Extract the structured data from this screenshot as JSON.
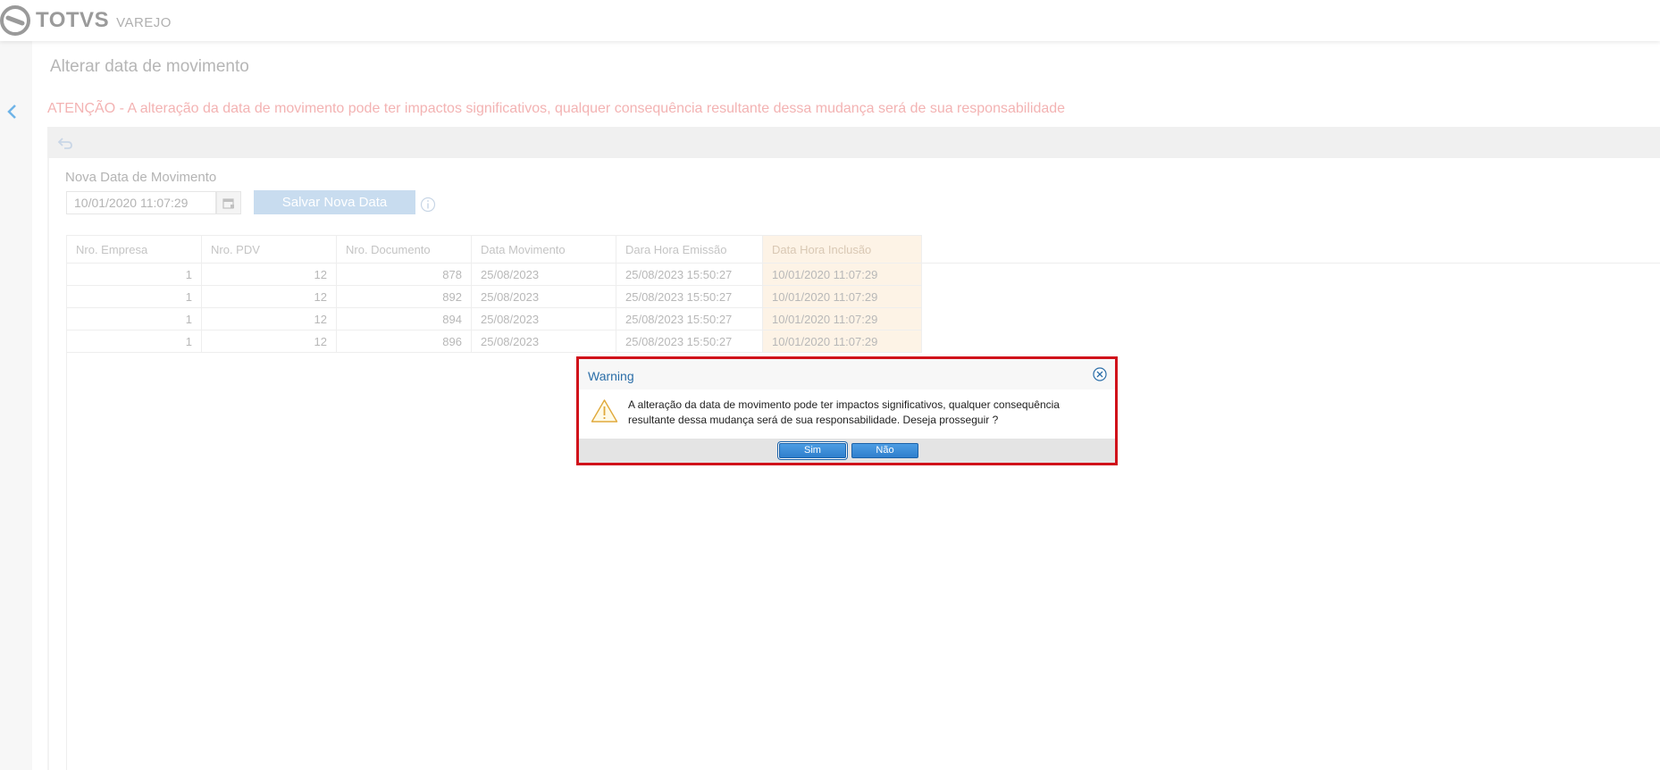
{
  "brand": {
    "name": "TOTVS",
    "product": "VAREJO"
  },
  "page": {
    "title": "Alterar data de movimento",
    "attention": "ATENÇÃO - A alteração da data de movimento pode ter impactos significativos, qualquer consequência resultante dessa mudança será de sua responsabilidade"
  },
  "form": {
    "label": "Nova Data de Movimento",
    "date_value": "10/01/2020 11:07:29",
    "save_label": "Salvar Nova Data"
  },
  "table": {
    "columns": [
      "Nro. Empresa",
      "Nro. PDV",
      "Nro. Documento",
      "Data Movimento",
      "Dara Hora Emissão",
      "Data Hora Inclusão"
    ],
    "rows": [
      [
        "1",
        "12",
        "878",
        "25/08/2023",
        "25/08/2023 15:50:27",
        "10/01/2020 11:07:29"
      ],
      [
        "1",
        "12",
        "892",
        "25/08/2023",
        "25/08/2023 15:50:27",
        "10/01/2020 11:07:29"
      ],
      [
        "1",
        "12",
        "894",
        "25/08/2023",
        "25/08/2023 15:50:27",
        "10/01/2020 11:07:29"
      ],
      [
        "1",
        "12",
        "896",
        "25/08/2023",
        "25/08/2023 15:50:27",
        "10/01/2020 11:07:29"
      ]
    ]
  },
  "dialog": {
    "title": "Warning",
    "message_line1": "A alteração da data de movimento pode ter impactos significativos, qualquer consequência",
    "message_line2": "resultante dessa mudança será de sua responsabilidade. Deseja prosseguir ?",
    "yes_label": "Sim",
    "no_label": "Não"
  },
  "colors": {
    "accent": "#2f7fcd",
    "attention": "#f3b3b3",
    "dialog_border": "#d0101a",
    "highlight_column": "#fdf3e6"
  },
  "icons": [
    "totvs-logo-icon",
    "back-arrow-icon",
    "undo-icon",
    "calendar-icon",
    "info-icon",
    "close-circle-icon",
    "warning-triangle-icon"
  ]
}
